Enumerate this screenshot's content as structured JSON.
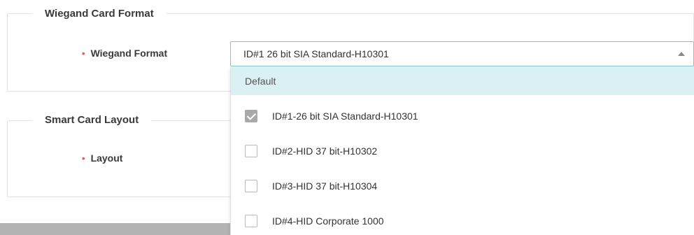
{
  "wiegand_section": {
    "title": "Wiegand Card Format",
    "field_label": "Wiegand Format",
    "required_marker": "•",
    "selected_value": "ID#1 26 bit SIA Standard-H10301"
  },
  "smart_card_section": {
    "title": "Smart Card Layout",
    "field_label": "Layout",
    "required_marker": "•"
  },
  "dropdown": {
    "default_label": "Default",
    "options": [
      {
        "label": "ID#1-26 bit SIA Standard-H10301",
        "checked": true
      },
      {
        "label": "ID#2-HID 37 bit-H10302",
        "checked": false
      },
      {
        "label": "ID#3-HID 37 bit-H10304",
        "checked": false
      },
      {
        "label": "ID#4-HID Corporate 1000",
        "checked": false
      }
    ]
  },
  "colors": {
    "accent_border": "#7ec8d0",
    "highlight": "#daf0f2",
    "required": "#e05a5a"
  }
}
